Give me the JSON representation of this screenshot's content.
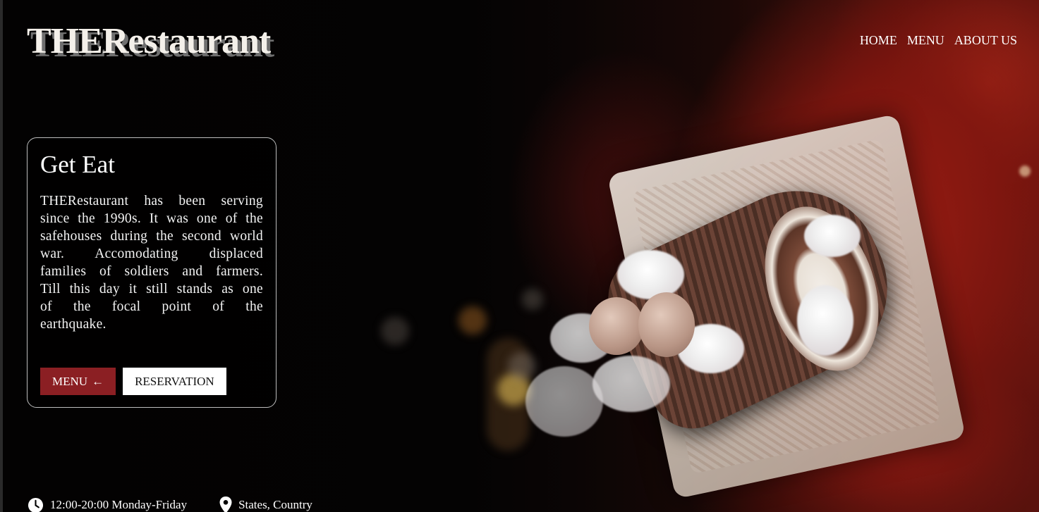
{
  "brand": {
    "logo_text": "THERestaurant"
  },
  "nav": {
    "items": [
      {
        "label": "HOME"
      },
      {
        "label": "MENU"
      },
      {
        "label": "ABOUT US"
      }
    ]
  },
  "hero_card": {
    "title": "Get Eat",
    "description": "THERestaurant has been serving since the 1990s. It was one of the safehouses during the second world war. Accomodating displaced families of soldiers and farmers. Till this day it still stands as one of the focal point of the earthquake.",
    "menu_button": {
      "label": "MENU",
      "icon": "left-arrow-icon",
      "glyph": "←"
    },
    "reservation_button": {
      "label": "RESERVATION"
    }
  },
  "info": {
    "hours": {
      "icon": "clock-icon",
      "text": "12:00-20:00 Monday-Friday"
    },
    "location": {
      "icon": "location-pin-icon",
      "text": "States, Country"
    }
  },
  "colors": {
    "accent": "#8b1f23",
    "text": "#ffffff",
    "background": "#050303"
  }
}
